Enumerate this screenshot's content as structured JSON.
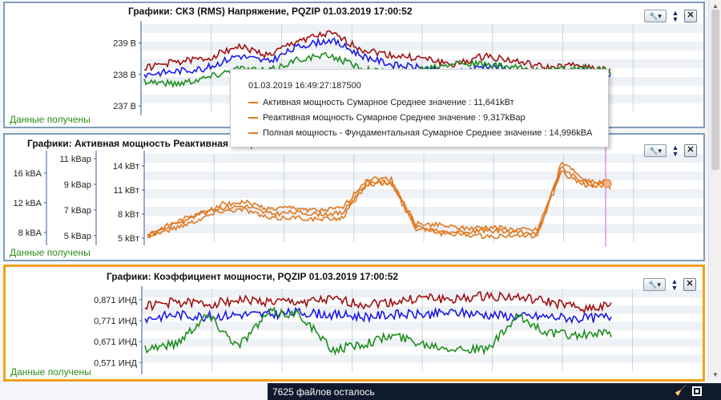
{
  "panels": [
    {
      "title": "Графики: СКЗ (RMS) Напряжение, PQZIP 01.03.2019 17:00:52",
      "status": "Данные получены",
      "axis_ticks": [
        "239 В",
        "238 В",
        "237 В"
      ]
    },
    {
      "title": "Графики: Активная мощность  Реактивная мощ",
      "status": "Данные получены",
      "axis1_ticks": [
        "16 kBA",
        "12 kBA",
        "8 kBA"
      ],
      "axis2_ticks": [
        "11 kBap",
        "9 kBap",
        "7 kBap",
        "5 kBap"
      ],
      "axis3_ticks": [
        "14 kBт",
        "11 kBт",
        "8 kBт",
        "5 kBт"
      ]
    },
    {
      "title": "Графики: Коэффициент мощности, PQZIP 01.03.2019 17:00:52",
      "status": "Данные получены",
      "axis_ticks": [
        "0,871 ИНД",
        "0,771 ИНД",
        "0,671 ИНД",
        "0,571 ИНД"
      ]
    }
  ],
  "tooltip": {
    "timestamp": "01.03.2019 16:49:27:187500",
    "rows": [
      "Активная мощность Сумарное Среднее значение : 11,641kВт",
      "Реактивная мощность Сумарное Среднее значение : 9,317kBap",
      "Полная мощность - Фундаментальная Сумарное Среднее значение : 14,996kBA"
    ]
  },
  "taskbar": {
    "text": "7625 файлов осталось"
  },
  "colors": {
    "red": "#a01010",
    "blue": "#1a1ae6",
    "green": "#1e8e1e",
    "orange": "#e07820",
    "cursor": "#d660d6",
    "border": "#7f9db9",
    "active_border": "#f0a21e"
  },
  "chart_data": [
    {
      "type": "line",
      "ylim": [
        236.8,
        239.6
      ],
      "y_ticks": [
        239,
        238,
        237
      ],
      "series": [
        {
          "color": "red",
          "values": [
            238.2,
            238.4,
            238.5,
            238.9,
            238.6,
            239.1,
            239.3,
            238.8,
            238.6,
            238.5,
            238.3,
            238.6,
            238.4,
            238.2,
            238.3,
            238.1
          ]
        },
        {
          "color": "blue",
          "values": [
            238.0,
            238.1,
            238.2,
            238.6,
            238.4,
            238.9,
            239.1,
            238.6,
            238.3,
            238.2,
            238.0,
            238.3,
            238.1,
            238.0,
            238.1,
            238.0
          ]
        },
        {
          "color": "green",
          "values": [
            237.8,
            237.7,
            237.9,
            238.2,
            238.1,
            238.5,
            238.6,
            238.2,
            238.0,
            238.2,
            238.4,
            238.3,
            238.2,
            238.1,
            238.2,
            238.1
          ]
        }
      ]
    },
    {
      "type": "line",
      "ylim": [
        4.5,
        15.5
      ],
      "y_ticks": [
        14,
        11,
        8,
        5
      ],
      "series": [
        {
          "color": "orange",
          "values": [
            5.2,
            6.5,
            7.8,
            9.2,
            9.5,
            8.6,
            8.8,
            8.4,
            8.7,
            12.4,
            12.4,
            6.5,
            5.6,
            5.4,
            5.2,
            5.3,
            5.2,
            14.4,
            12.2,
            11.9
          ]
        },
        {
          "color": "orange",
          "values": [
            5.5,
            6.8,
            8.0,
            8.8,
            9.0,
            8.0,
            8.2,
            8.0,
            8.1,
            12.0,
            12.0,
            6.8,
            6.6,
            6.2,
            6.4,
            6.1,
            6.0,
            13.8,
            11.8,
            11.6
          ]
        },
        {
          "color": "orange",
          "values": [
            5.3,
            6.1,
            7.2,
            8.4,
            8.6,
            7.4,
            7.6,
            7.3,
            7.5,
            11.8,
            11.8,
            6.2,
            6.0,
            5.8,
            5.9,
            5.7,
            5.6,
            13.2,
            11.5,
            11.3
          ]
        }
      ]
    },
    {
      "type": "line",
      "ylim": [
        0.53,
        0.92
      ],
      "y_ticks": [
        0.871,
        0.771,
        0.671,
        0.571
      ],
      "series": [
        {
          "color": "red",
          "values": [
            0.84,
            0.86,
            0.85,
            0.87,
            0.86,
            0.86,
            0.87,
            0.85,
            0.86,
            0.88,
            0.87,
            0.89,
            0.88,
            0.86,
            0.83,
            0.84
          ]
        },
        {
          "color": "blue",
          "values": [
            0.78,
            0.8,
            0.79,
            0.8,
            0.8,
            0.81,
            0.8,
            0.79,
            0.8,
            0.8,
            0.81,
            0.8,
            0.79,
            0.79,
            0.78,
            0.79
          ]
        },
        {
          "color": "green",
          "values": [
            0.64,
            0.66,
            0.8,
            0.65,
            0.81,
            0.8,
            0.63,
            0.66,
            0.7,
            0.66,
            0.64,
            0.63,
            0.79,
            0.71,
            0.7,
            0.71
          ]
        }
      ]
    }
  ]
}
